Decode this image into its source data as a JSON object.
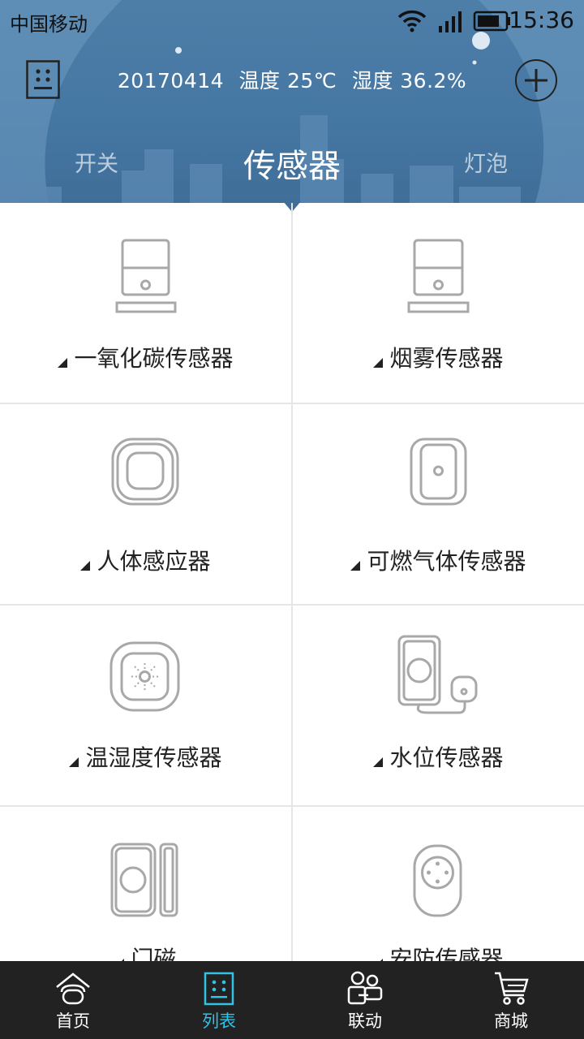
{
  "status_bar": {
    "carrier": "中国移动",
    "time": "15:36"
  },
  "header": {
    "date": "20170414",
    "temperature": "温度 25℃",
    "humidity": "湿度 36.2%",
    "tabs": {
      "left": "开关",
      "active": "传感器",
      "right": "灯泡"
    }
  },
  "sensors": [
    {
      "label": "一氧化碳传感器",
      "icon": "co-sensor-icon"
    },
    {
      "label": "烟雾传感器",
      "icon": "smoke-sensor-icon"
    },
    {
      "label": "人体感应器",
      "icon": "motion-sensor-icon"
    },
    {
      "label": "可燃气体传感器",
      "icon": "gas-sensor-icon"
    },
    {
      "label": "温湿度传感器",
      "icon": "temp-humidity-sensor-icon"
    },
    {
      "label": "水位传感器",
      "icon": "water-level-sensor-icon"
    },
    {
      "label": "门磁",
      "icon": "door-sensor-icon"
    },
    {
      "label": "安防传感器",
      "icon": "security-sensor-icon"
    }
  ],
  "bottom_nav": [
    {
      "label": "首页",
      "icon": "home-icon"
    },
    {
      "label": "列表",
      "icon": "list-icon",
      "active": true
    },
    {
      "label": "联动",
      "icon": "linkage-icon"
    },
    {
      "label": "商城",
      "icon": "cart-icon"
    }
  ],
  "colors": {
    "header_blue": "#4577a3",
    "active_nav": "#2fc3e6",
    "nav_bg": "#222222"
  }
}
